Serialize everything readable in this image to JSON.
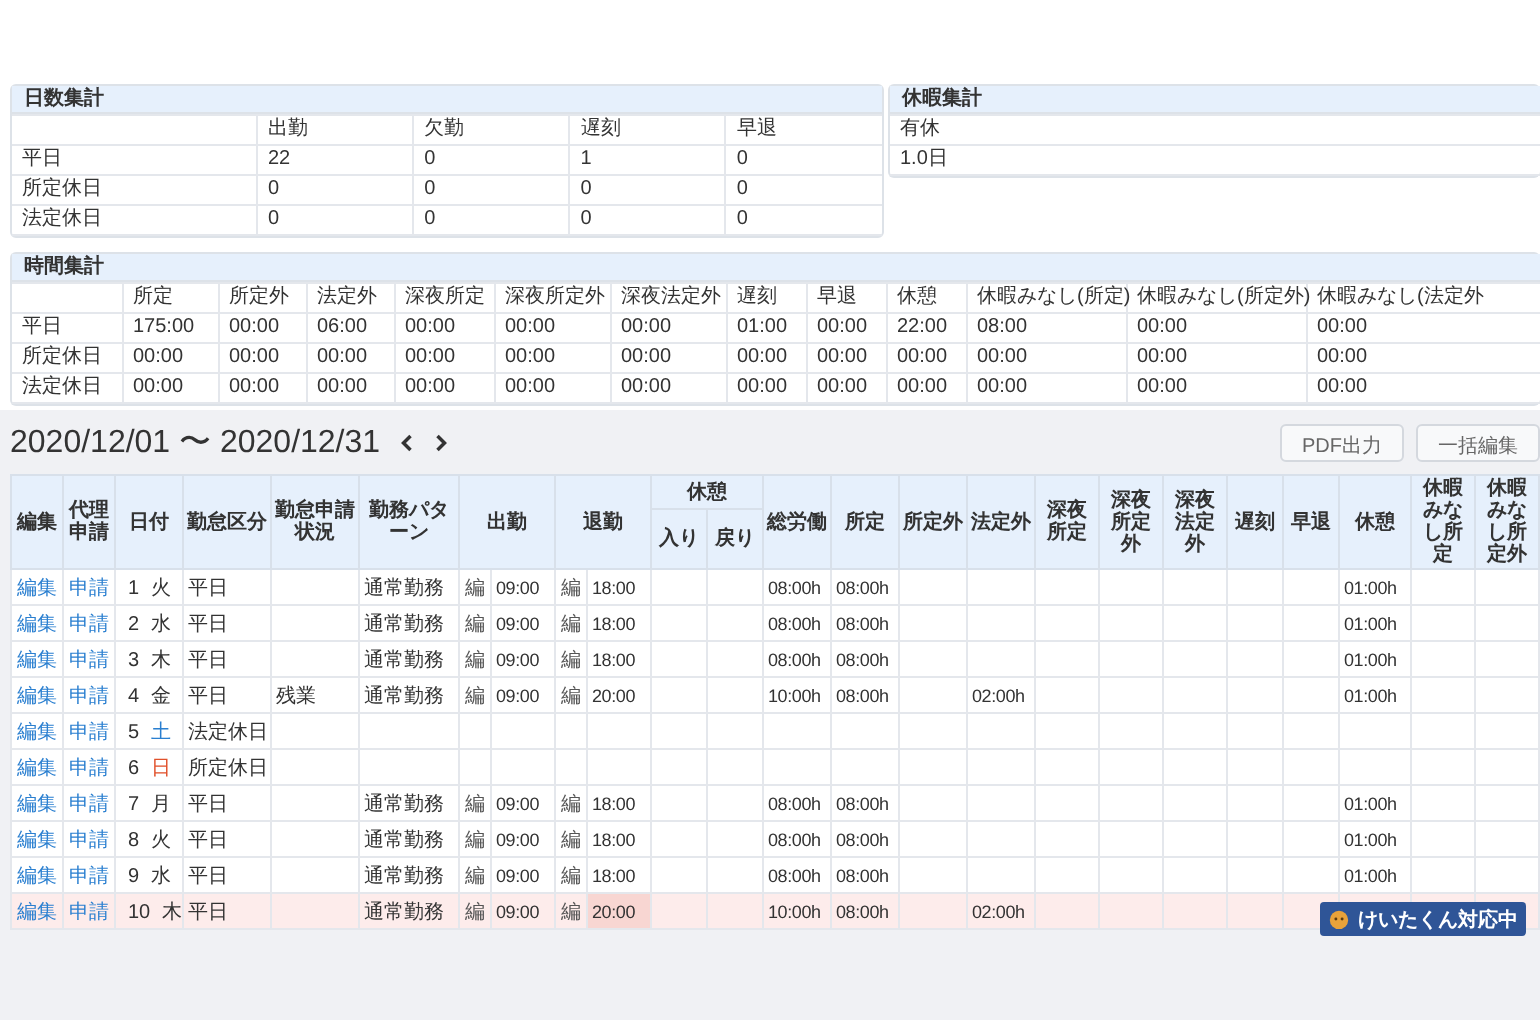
{
  "day_summary": {
    "title": "日数集計",
    "columns": [
      "出勤",
      "欠勤",
      "遅刻",
      "早退"
    ],
    "rows": [
      {
        "label": "平日",
        "cells": [
          "22",
          "0",
          "1",
          "0"
        ]
      },
      {
        "label": "所定休日",
        "cells": [
          "0",
          "0",
          "0",
          "0"
        ]
      },
      {
        "label": "法定休日",
        "cells": [
          "0",
          "0",
          "0",
          "0"
        ]
      }
    ]
  },
  "leave_summary": {
    "title": "休暇集計",
    "columns": [
      "有休"
    ],
    "rows": [
      {
        "cells": [
          "1.0日"
        ]
      }
    ]
  },
  "time_summary": {
    "title": "時間集計",
    "columns": [
      "所定",
      "所定外",
      "法定外",
      "深夜所定",
      "深夜所定外",
      "深夜法定外",
      "遅刻",
      "早退",
      "休憩",
      "休暇みなし(所定)",
      "休暇みなし(所定外)",
      "休暇みなし(法定外"
    ],
    "rows": [
      {
        "label": "平日",
        "cells": [
          "175:00",
          "00:00",
          "06:00",
          "00:00",
          "00:00",
          "00:00",
          "01:00",
          "00:00",
          "22:00",
          "08:00",
          "00:00",
          "00:00"
        ]
      },
      {
        "label": "所定休日",
        "cells": [
          "00:00",
          "00:00",
          "00:00",
          "00:00",
          "00:00",
          "00:00",
          "00:00",
          "00:00",
          "00:00",
          "00:00",
          "00:00",
          "00:00"
        ]
      },
      {
        "label": "法定休日",
        "cells": [
          "00:00",
          "00:00",
          "00:00",
          "00:00",
          "00:00",
          "00:00",
          "00:00",
          "00:00",
          "00:00",
          "00:00",
          "00:00",
          "00:00"
        ]
      }
    ]
  },
  "period": {
    "label": "2020/12/01 〜 2020/12/31"
  },
  "buttons": [
    "PDF出力",
    "一括編集"
  ],
  "attendance": {
    "columns": [
      {
        "label": "編集",
        "kind": "link"
      },
      {
        "label": "代理申請",
        "kind": "link"
      },
      {
        "label": "日付",
        "kind": "date"
      },
      {
        "label": "勤怠区分",
        "kind": "text"
      },
      {
        "label": "勤怠申請状況",
        "kind": "text"
      },
      {
        "label": "勤務パターン",
        "kind": "text"
      },
      {
        "label": "出勤",
        "kind": "punch"
      },
      {
        "label": "退勤",
        "kind": "punch"
      },
      {
        "label": "休憩",
        "kind": "group",
        "children": [
          {
            "label": "入り"
          },
          {
            "label": "戻り"
          }
        ]
      },
      {
        "label": "総労働",
        "kind": "num"
      },
      {
        "label": "所定",
        "kind": "num"
      },
      {
        "label": "所定外",
        "kind": "num"
      },
      {
        "label": "法定外",
        "kind": "num"
      },
      {
        "label": "深夜所定",
        "kind": "num"
      },
      {
        "label": "深夜所定外",
        "kind": "num"
      },
      {
        "label": "深夜法定外",
        "kind": "num"
      },
      {
        "label": "遅刻",
        "kind": "num"
      },
      {
        "label": "早退",
        "kind": "num"
      },
      {
        "label": "休憩",
        "kind": "num"
      },
      {
        "label": "休暇みなし所定",
        "kind": "num"
      },
      {
        "label": "休暇みなし所定外",
        "kind": "num"
      }
    ],
    "rows": [
      {
        "highlighted": false,
        "cells": [
          "編集",
          "申請",
          {
            "day": "1",
            "weekday": {
              "text": "火",
              "color": "#333333"
            }
          },
          "平日",
          null,
          "通常勤務",
          {
            "mark": "編",
            "time": "09:00",
            "flagged": false
          },
          {
            "mark": "編",
            "time": "18:00",
            "flagged": false
          },
          [
            null,
            null
          ],
          "08:00h",
          "08:00h",
          null,
          null,
          null,
          null,
          null,
          null,
          null,
          "01:00h",
          null,
          null
        ]
      },
      {
        "highlighted": false,
        "cells": [
          "編集",
          "申請",
          {
            "day": "2",
            "weekday": {
              "text": "水",
              "color": "#333333"
            }
          },
          "平日",
          null,
          "通常勤務",
          {
            "mark": "編",
            "time": "09:00",
            "flagged": false
          },
          {
            "mark": "編",
            "time": "18:00",
            "flagged": false
          },
          [
            null,
            null
          ],
          "08:00h",
          "08:00h",
          null,
          null,
          null,
          null,
          null,
          null,
          null,
          "01:00h",
          null,
          null
        ]
      },
      {
        "highlighted": false,
        "cells": [
          "編集",
          "申請",
          {
            "day": "3",
            "weekday": {
              "text": "木",
              "color": "#333333"
            }
          },
          "平日",
          null,
          "通常勤務",
          {
            "mark": "編",
            "time": "09:00",
            "flagged": false
          },
          {
            "mark": "編",
            "time": "18:00",
            "flagged": false
          },
          [
            null,
            null
          ],
          "08:00h",
          "08:00h",
          null,
          null,
          null,
          null,
          null,
          null,
          null,
          "01:00h",
          null,
          null
        ]
      },
      {
        "highlighted": false,
        "cells": [
          "編集",
          "申請",
          {
            "day": "4",
            "weekday": {
              "text": "金",
              "color": "#333333"
            }
          },
          "平日",
          "残業",
          "通常勤務",
          {
            "mark": "編",
            "time": "09:00",
            "flagged": false
          },
          {
            "mark": "編",
            "time": "20:00",
            "flagged": false
          },
          [
            null,
            null
          ],
          "10:00h",
          "08:00h",
          null,
          "02:00h",
          null,
          null,
          null,
          null,
          null,
          "01:00h",
          null,
          null
        ]
      },
      {
        "highlighted": false,
        "cells": [
          "編集",
          "申請",
          {
            "day": "5",
            "weekday": {
              "text": "土",
              "color": "#2a7fd0"
            }
          },
          "法定休日",
          null,
          null,
          null,
          null,
          [
            null,
            null
          ],
          null,
          null,
          null,
          null,
          null,
          null,
          null,
          null,
          null,
          null,
          null,
          null
        ]
      },
      {
        "highlighted": false,
        "cells": [
          "編集",
          "申請",
          {
            "day": "6",
            "weekday": {
              "text": "日",
              "color": "#e0502a"
            }
          },
          "所定休日",
          null,
          null,
          null,
          null,
          [
            null,
            null
          ],
          null,
          null,
          null,
          null,
          null,
          null,
          null,
          null,
          null,
          null,
          null,
          null
        ]
      },
      {
        "highlighted": false,
        "cells": [
          "編集",
          "申請",
          {
            "day": "7",
            "weekday": {
              "text": "月",
              "color": "#333333"
            }
          },
          "平日",
          null,
          "通常勤務",
          {
            "mark": "編",
            "time": "09:00",
            "flagged": false
          },
          {
            "mark": "編",
            "time": "18:00",
            "flagged": false
          },
          [
            null,
            null
          ],
          "08:00h",
          "08:00h",
          null,
          null,
          null,
          null,
          null,
          null,
          null,
          "01:00h",
          null,
          null
        ]
      },
      {
        "highlighted": false,
        "cells": [
          "編集",
          "申請",
          {
            "day": "8",
            "weekday": {
              "text": "火",
              "color": "#333333"
            }
          },
          "平日",
          null,
          "通常勤務",
          {
            "mark": "編",
            "time": "09:00",
            "flagged": false
          },
          {
            "mark": "編",
            "time": "18:00",
            "flagged": false
          },
          [
            null,
            null
          ],
          "08:00h",
          "08:00h",
          null,
          null,
          null,
          null,
          null,
          null,
          null,
          "01:00h",
          null,
          null
        ]
      },
      {
        "highlighted": false,
        "cells": [
          "編集",
          "申請",
          {
            "day": "9",
            "weekday": {
              "text": "水",
              "color": "#333333"
            }
          },
          "平日",
          null,
          "通常勤務",
          {
            "mark": "編",
            "time": "09:00",
            "flagged": false
          },
          {
            "mark": "編",
            "time": "18:00",
            "flagged": false
          },
          [
            null,
            null
          ],
          "08:00h",
          "08:00h",
          null,
          null,
          null,
          null,
          null,
          null,
          null,
          "01:00h",
          null,
          null
        ]
      },
      {
        "highlighted": true,
        "cells": [
          "編集",
          "申請",
          {
            "day": "10",
            "weekday": {
              "text": "木",
              "color": "#333333"
            }
          },
          "平日",
          null,
          "通常勤務",
          {
            "mark": "編",
            "time": "09:00",
            "flagged": false
          },
          {
            "mark": "編",
            "time": "20:00",
            "flagged": true
          },
          [
            null,
            null
          ],
          "10:00h",
          "08:00h",
          null,
          "02:00h",
          null,
          null,
          null,
          null,
          null,
          null,
          null,
          null
        ]
      }
    ]
  },
  "support_badge": {
    "text": "けいたくん対応中"
  }
}
